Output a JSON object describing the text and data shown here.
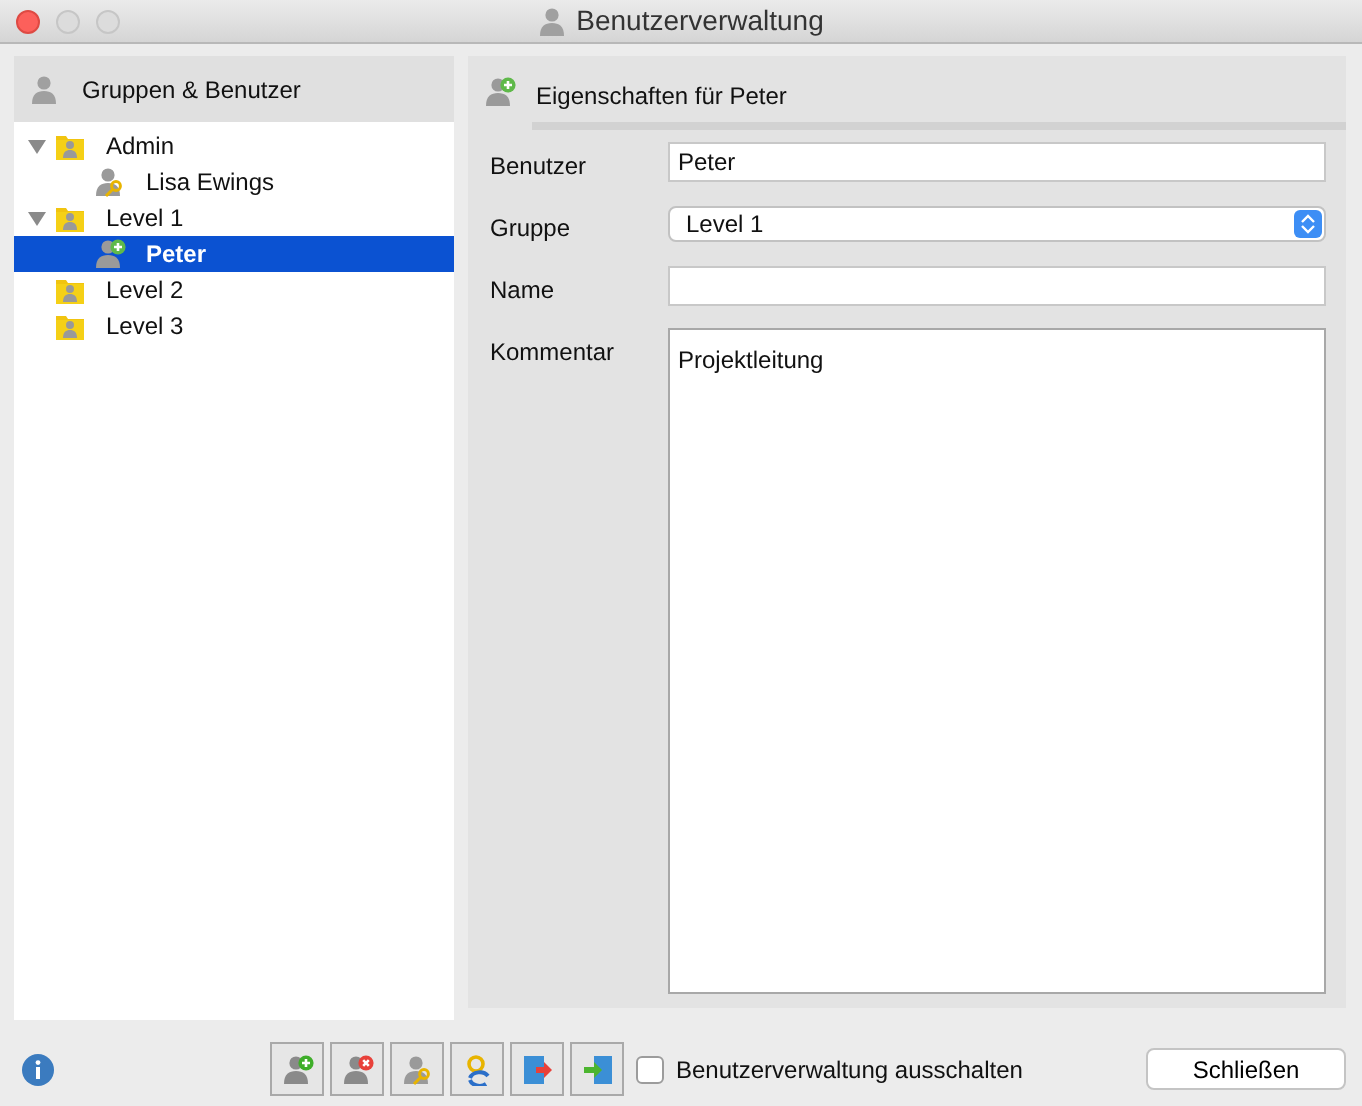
{
  "window": {
    "title": "Benutzerverwaltung"
  },
  "tree": {
    "title": "Gruppen & Benutzer",
    "items": [
      {
        "label": "Admin",
        "kind": "group",
        "selected": false,
        "expanded": true,
        "children": [
          {
            "label": "Lisa Ewings",
            "kind": "key-user",
            "selected": false
          }
        ]
      },
      {
        "label": "Level 1",
        "kind": "group",
        "selected": false,
        "expanded": true,
        "children": [
          {
            "label": "Peter",
            "kind": "new-user",
            "selected": true
          }
        ]
      },
      {
        "label": "Level 2",
        "kind": "group",
        "selected": false
      },
      {
        "label": "Level 3",
        "kind": "group",
        "selected": false
      }
    ]
  },
  "properties": {
    "title": "Eigenschaften für Peter",
    "fields": [
      {
        "label": "Benutzer",
        "kind": "text",
        "value": "Peter"
      },
      {
        "label": "Gruppe",
        "kind": "select",
        "value": "Level 1"
      },
      {
        "label": "Name",
        "kind": "text"
      },
      {
        "label": "Kommentar",
        "kind": "textarea",
        "value": "Projektleitung"
      }
    ]
  },
  "toolbar": [
    {
      "kind": "add-user"
    },
    {
      "kind": "remove-user"
    },
    {
      "kind": "key-user"
    },
    {
      "kind": "swap"
    },
    {
      "kind": "export"
    },
    {
      "kind": "import"
    }
  ],
  "disable_option": {
    "label": "Benutzerverwaltung ausschalten",
    "checked": false
  },
  "close_button": "Schließen"
}
